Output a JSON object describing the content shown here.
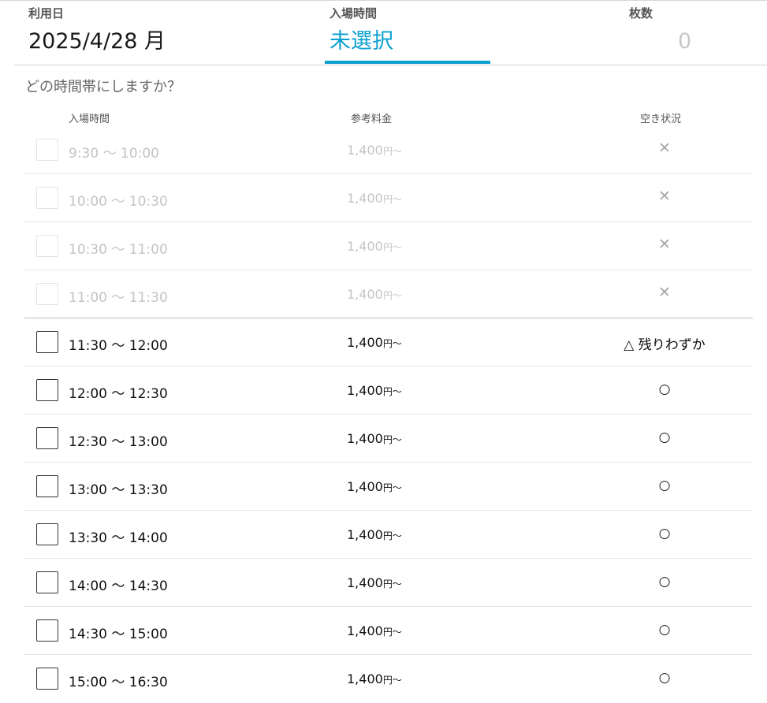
{
  "summary": {
    "date_label": "利用日",
    "date_value": "2025/4/28 月",
    "time_label": "入場時間",
    "time_value": "未選択",
    "count_label": "枚数",
    "count_value": "0"
  },
  "question": "どの時間帯にしますか？",
  "columns": {
    "entry_time": "入場時間",
    "price": "参考料金",
    "availability": "空き状況"
  },
  "colors": {
    "accent": "#0aa0d0",
    "disabled_text": "#c4c4c4"
  },
  "slots": [
    {
      "time": "9:30 〜 10:00",
      "price": "1,400",
      "unit": "円〜",
      "availability": "✕",
      "disabled": true
    },
    {
      "time": "10:00 〜 10:30",
      "price": "1,400",
      "unit": "円〜",
      "availability": "✕",
      "disabled": true
    },
    {
      "time": "10:30 〜 11:00",
      "price": "1,400",
      "unit": "円〜",
      "availability": "✕",
      "disabled": true
    },
    {
      "time": "11:00 〜 11:30",
      "price": "1,400",
      "unit": "円〜",
      "availability": "✕",
      "disabled": true
    },
    {
      "time": "11:30 〜 12:00",
      "price": "1,400",
      "unit": "円〜",
      "availability": "△ 残りわずか",
      "disabled": false
    },
    {
      "time": "12:00 〜 12:30",
      "price": "1,400",
      "unit": "円〜",
      "availability": "○",
      "disabled": false
    },
    {
      "time": "12:30 〜 13:00",
      "price": "1,400",
      "unit": "円〜",
      "availability": "○",
      "disabled": false
    },
    {
      "time": "13:00 〜 13:30",
      "price": "1,400",
      "unit": "円〜",
      "availability": "○",
      "disabled": false
    },
    {
      "time": "13:30 〜 14:00",
      "price": "1,400",
      "unit": "円〜",
      "availability": "○",
      "disabled": false
    },
    {
      "time": "14:00 〜 14:30",
      "price": "1,400",
      "unit": "円〜",
      "availability": "○",
      "disabled": false
    },
    {
      "time": "14:30 〜 15:00",
      "price": "1,400",
      "unit": "円〜",
      "availability": "○",
      "disabled": false
    },
    {
      "time": "15:00 〜 16:30",
      "price": "1,400",
      "unit": "円〜",
      "availability": "○",
      "disabled": false
    }
  ]
}
